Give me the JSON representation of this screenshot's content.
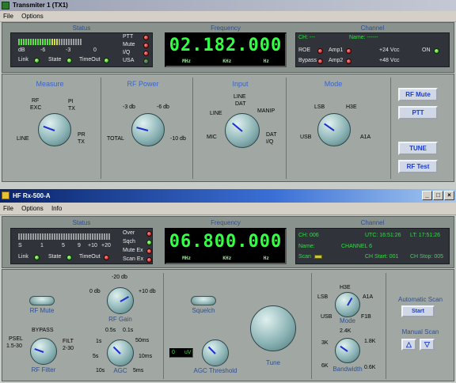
{
  "tx": {
    "title": "Transmiter 1  (TX1)",
    "menu": [
      "File",
      "Options"
    ],
    "status": {
      "header": "Status",
      "scale": [
        "dB",
        "-6",
        "-3",
        "0"
      ],
      "leds": [
        "Link",
        "State",
        "TimeOut"
      ],
      "flags": [
        "PTT",
        "Mute",
        "I/Q",
        "USA"
      ]
    },
    "frequency": {
      "header": "Frequency",
      "value": "02.182.000",
      "units": [
        "MHz",
        "KHz",
        "Hz"
      ]
    },
    "channel": {
      "header": "Channel",
      "ch_label": "CH: ---",
      "name_label": "Name: ------",
      "items": [
        "ROE",
        "Amp1",
        "Bypass",
        "Amp2",
        "+24 Vcc",
        "ON",
        "+48 Vcc"
      ]
    },
    "measure": {
      "header": "Measure",
      "labels": [
        "RF",
        "EXC",
        "PI",
        "TX",
        "PR",
        "TX",
        "LINE"
      ]
    },
    "rfpower": {
      "header": "RF Power",
      "labels": [
        "-3 db",
        "-6 db",
        "TOTAL",
        "-10 db"
      ]
    },
    "input": {
      "header": "Input",
      "labels": [
        "LINE",
        "DAT",
        "LINE",
        "MANIP",
        "MIC",
        "DAT",
        "I/Q"
      ]
    },
    "mode": {
      "header": "Mode",
      "labels": [
        "LSB",
        "H3E",
        "USB",
        "A1A"
      ]
    },
    "buttons": [
      "RF Mute",
      "PTT",
      "TUNE",
      "RF Test"
    ]
  },
  "rx": {
    "title": "HF Rx-500-A",
    "menu": [
      "File",
      "Options",
      "Info"
    ],
    "status": {
      "header": "Status",
      "scale": [
        "S",
        "1",
        "5",
        "9",
        "+10",
        "+20"
      ],
      "leds": [
        "Link",
        "State",
        "TimeOut"
      ],
      "flags": [
        "Over",
        "Sqch",
        "Mute Ex",
        "Scan Ex"
      ]
    },
    "frequency": {
      "header": "Frequency",
      "value": "06.800.000",
      "units": [
        "MHz",
        "KHz",
        "Hz"
      ]
    },
    "channel": {
      "header": "Channel",
      "ch": "CH: 006",
      "utc": "UTC: 16:51:26",
      "lt": "LT: 17:51:26",
      "name_label": "Name:",
      "name_value": "CHANNEL 6",
      "scan_label": "Scan",
      "ch_start": "CH Start: 001",
      "ch_stop": "CH Stop: 005"
    },
    "controls": {
      "rf_mute": "RF Mute",
      "rf_gain": "RF Gain",
      "rf_gain_labels": [
        "-20 db",
        "0 db",
        "+10 db"
      ],
      "squelch": "Squelch",
      "rf_filter": "RF Filter",
      "rf_filter_labels": [
        "BYPASS",
        "PSEL",
        "1.5-30",
        "FILT",
        "2-30"
      ],
      "agc": "AGC",
      "agc_labels": [
        "0.5s",
        "0.1s",
        "1s",
        "50ms",
        "5s",
        "10ms",
        "10s",
        "5ms"
      ],
      "agc_threshold": "AGC Threshold",
      "threshold_value": "0",
      "threshold_unit": "uV",
      "tune": "Tune",
      "mode": "Mode",
      "mode_labels": [
        "H3E",
        "LSB",
        "A1A",
        "USB",
        "F1B"
      ],
      "bandwidth": "Bandwidth",
      "bandwidth_labels": [
        "2.4K",
        "3K",
        "1.8K",
        "6K",
        "0.6K"
      ],
      "auto_scan": "Automatic Scan",
      "start": "Start",
      "manual_scan": "Manual Scan"
    }
  }
}
